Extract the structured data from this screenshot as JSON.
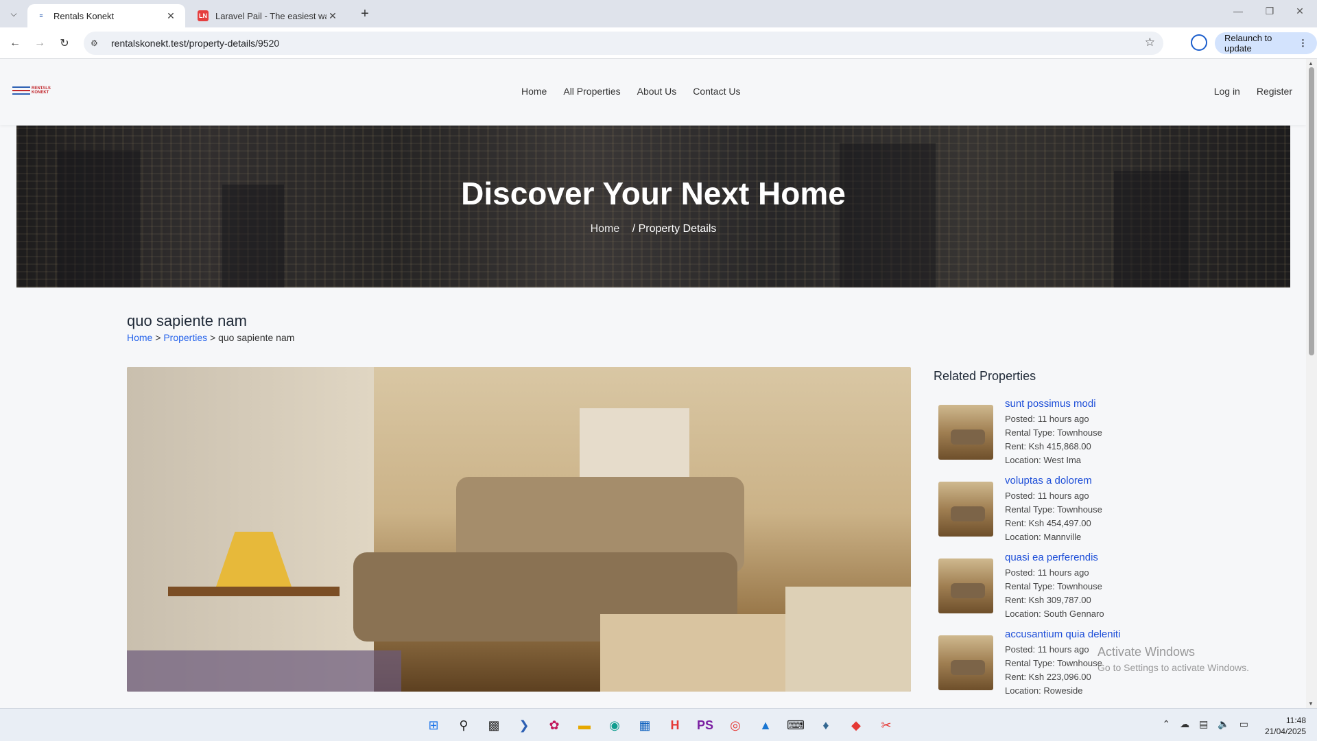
{
  "browser": {
    "tabs": [
      {
        "title": "Rentals Konekt",
        "favicon": "rentals-favicon",
        "active": true
      },
      {
        "title": "Laravel Pail - The easiest way to",
        "favicon": "laravel-news-favicon",
        "active": false
      }
    ],
    "url": "rentalskonekt.test/property-details/9520",
    "relaunch_label": "Relaunch to update"
  },
  "site": {
    "logo_text_line1": "RENTALS",
    "logo_text_line2": "KONEKT",
    "nav": [
      "Home",
      "All Properties",
      "About Us",
      "Contact Us"
    ],
    "auth": [
      "Log in",
      "Register"
    ]
  },
  "hero": {
    "title": "Discover Your Next Home",
    "crumb_home": "Home",
    "crumb_current": "/ Property Details"
  },
  "property": {
    "title": "quo sapiente nam",
    "breadcrumb": {
      "home": "Home",
      "sep1": ">",
      "properties": "Properties",
      "sep2": ">",
      "current": "quo sapiente nam"
    }
  },
  "related": {
    "heading": "Related Properties",
    "items": [
      {
        "title": "sunt possimus modi",
        "posted": "Posted: 11 hours ago",
        "type": "Rental Type: Townhouse",
        "rent": "Rent: Ksh 415,868.00",
        "location": "Location: West Ima"
      },
      {
        "title": "voluptas a dolorem",
        "posted": "Posted: 11 hours ago",
        "type": "Rental Type: Townhouse",
        "rent": "Rent: Ksh 454,497.00",
        "location": "Location: Mannville"
      },
      {
        "title": "quasi ea perferendis",
        "posted": "Posted: 11 hours ago",
        "type": "Rental Type: Townhouse",
        "rent": "Rent: Ksh 309,787.00",
        "location": "Location: South Gennaro"
      },
      {
        "title": "accusantium quia deleniti",
        "posted": "Posted: 11 hours ago",
        "type": "Rental Type: Townhouse",
        "rent": "Rent: Ksh 223,096.00",
        "location": "Location: Roweside"
      }
    ]
  },
  "watermark": {
    "line1": "Activate Windows",
    "line2": "Go to Settings to activate Windows."
  },
  "taskbar": {
    "icons": [
      "windows-start-icon",
      "search-icon",
      "file-explorer-dark-icon",
      "powershell-icon",
      "copilot-icon",
      "folder-icon",
      "edge-icon",
      "store-icon",
      "herd-icon",
      "phpstorm-icon",
      "chrome-icon",
      "photos-icon",
      "terminal-icon",
      "postgres-icon",
      "git-icon",
      "snipping-tool-icon"
    ],
    "time": "11:48",
    "date": "21/04/2025"
  },
  "colors": {
    "link": "#2563eb",
    "related_link": "#1d4ed8",
    "relaunch_bg": "#d3e3fd"
  }
}
